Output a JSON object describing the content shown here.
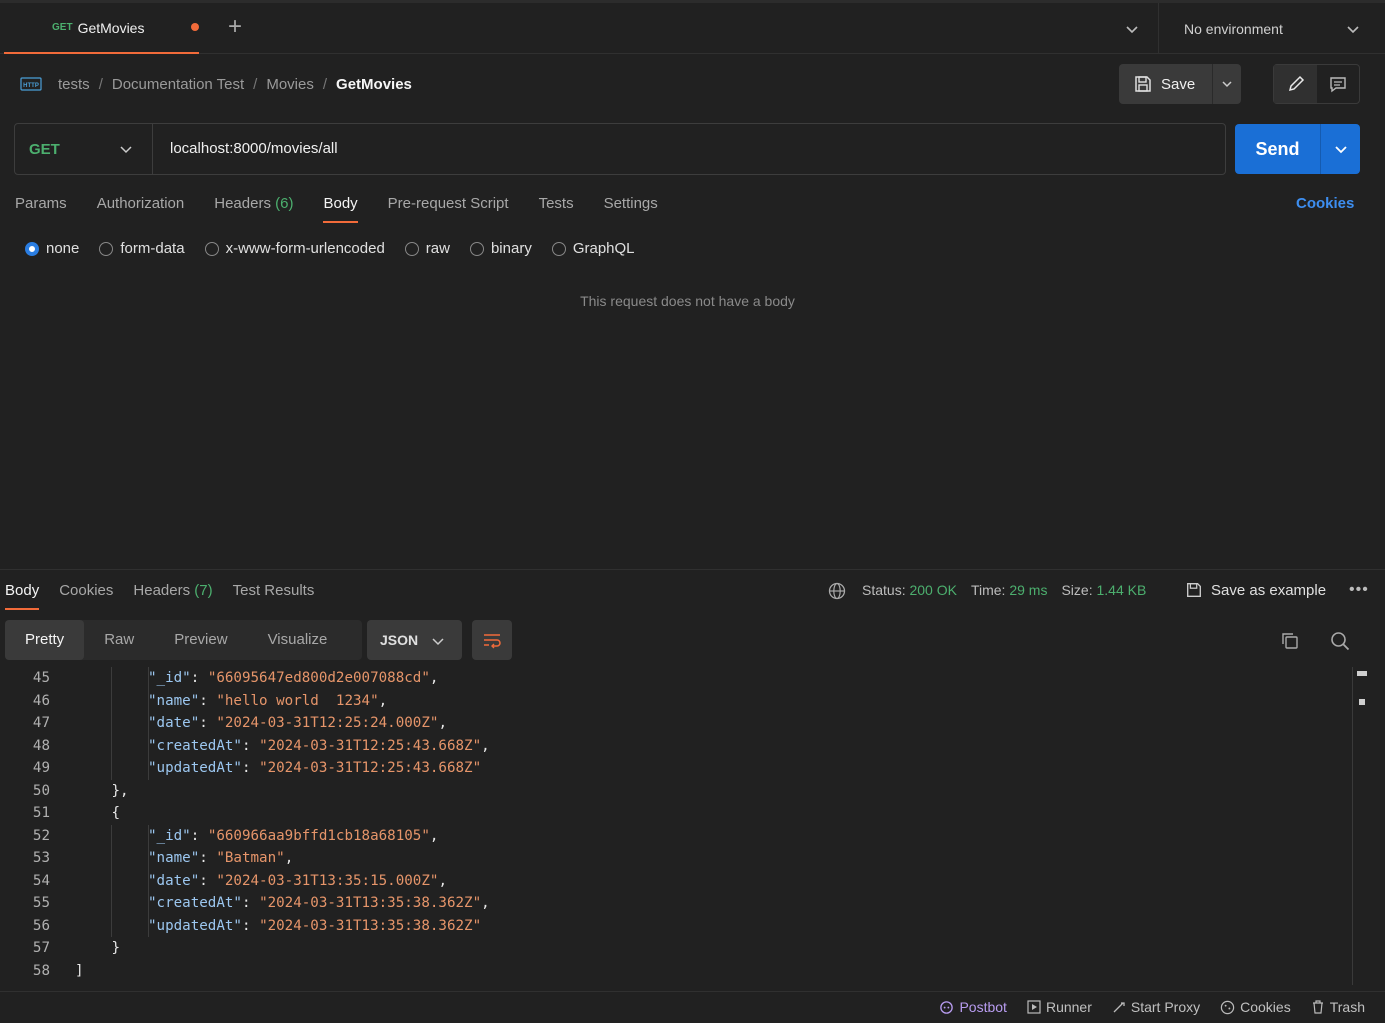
{
  "tab": {
    "method": "GET",
    "name": "GetMovies"
  },
  "environment": "No environment",
  "breadcrumb": {
    "items": [
      "tests",
      "Documentation Test",
      "Movies"
    ],
    "current": "GetMovies"
  },
  "toolbar": {
    "save_label": "Save"
  },
  "request": {
    "method": "GET",
    "url": "localhost:8000/movies/all",
    "send_label": "Send"
  },
  "request_tabs": [
    {
      "label": "Params",
      "count": ""
    },
    {
      "label": "Authorization",
      "count": ""
    },
    {
      "label": "Headers",
      "count": "(6)"
    },
    {
      "label": "Body",
      "count": ""
    },
    {
      "label": "Pre-request Script",
      "count": ""
    },
    {
      "label": "Tests",
      "count": ""
    },
    {
      "label": "Settings",
      "count": ""
    }
  ],
  "cookies_link": "Cookies",
  "body_types": [
    "none",
    "form-data",
    "x-www-form-urlencoded",
    "raw",
    "binary",
    "GraphQL"
  ],
  "body_type_selected": "none",
  "empty_body_message": "This request does not have a body",
  "response_tabs": [
    {
      "label": "Body",
      "count": ""
    },
    {
      "label": "Cookies",
      "count": ""
    },
    {
      "label": "Headers",
      "count": "(7)"
    },
    {
      "label": "Test Results",
      "count": ""
    }
  ],
  "response_status": {
    "status_label": "Status:",
    "status": "200 OK",
    "time_label": "Time:",
    "time": "29 ms",
    "size_label": "Size:",
    "size": "1.44 KB"
  },
  "save_example_label": "Save as example",
  "view_modes": [
    "Pretty",
    "Raw",
    "Preview",
    "Visualize"
  ],
  "format": "JSON",
  "code_lines": [
    {
      "n": "45",
      "indent": 2,
      "key": "_id",
      "value": "66095647ed800d2e007088cd",
      "comma": ","
    },
    {
      "n": "46",
      "indent": 2,
      "key": "name",
      "value": "hello world  1234",
      "comma": ","
    },
    {
      "n": "47",
      "indent": 2,
      "key": "date",
      "value": "2024-03-31T12:25:24.000Z",
      "comma": ","
    },
    {
      "n": "48",
      "indent": 2,
      "key": "createdAt",
      "value": "2024-03-31T12:25:43.668Z",
      "comma": ","
    },
    {
      "n": "49",
      "indent": 2,
      "key": "updatedAt",
      "value": "2024-03-31T12:25:43.668Z",
      "comma": ""
    },
    {
      "n": "50",
      "indent": 1,
      "raw": "},",
      "key": null
    },
    {
      "n": "51",
      "indent": 1,
      "raw": "{",
      "key": null
    },
    {
      "n": "52",
      "indent": 2,
      "key": "_id",
      "value": "660966aa9bffd1cb18a68105",
      "comma": ","
    },
    {
      "n": "53",
      "indent": 2,
      "key": "name",
      "value": "Batman",
      "comma": ","
    },
    {
      "n": "54",
      "indent": 2,
      "key": "date",
      "value": "2024-03-31T13:35:15.000Z",
      "comma": ","
    },
    {
      "n": "55",
      "indent": 2,
      "key": "createdAt",
      "value": "2024-03-31T13:35:38.362Z",
      "comma": ","
    },
    {
      "n": "56",
      "indent": 2,
      "key": "updatedAt",
      "value": "2024-03-31T13:35:38.362Z",
      "comma": ""
    },
    {
      "n": "57",
      "indent": 1,
      "raw": "}",
      "key": null
    },
    {
      "n": "58",
      "indent": 0,
      "raw": "]",
      "key": null
    }
  ],
  "statusbar": [
    "Postbot",
    "Runner",
    "Start Proxy",
    "Cookies",
    "Trash"
  ]
}
